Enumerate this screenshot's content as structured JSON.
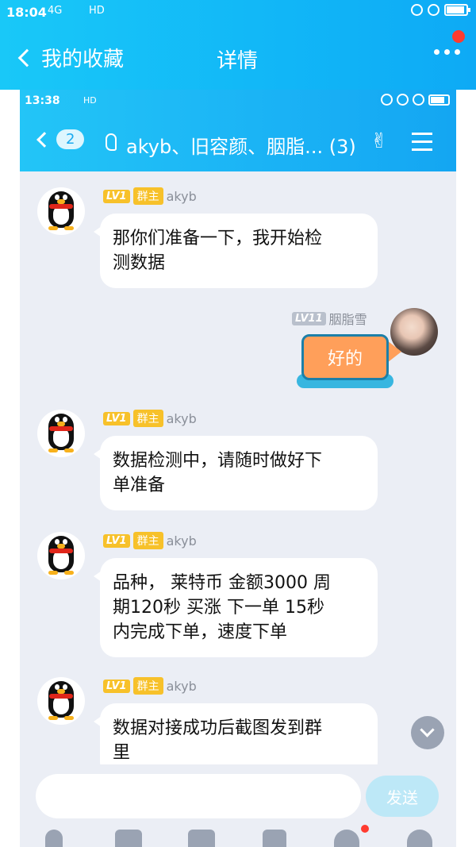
{
  "outer_status": {
    "time": "18:04",
    "signal": "4G",
    "network": "HD"
  },
  "outer_header": {
    "back_label": "我的收藏",
    "title": "详情"
  },
  "inner_status": {
    "time": "13:38",
    "network": "HD"
  },
  "chat_header": {
    "unread_count": "2",
    "title": "akyb、旧容颜、胭脂...",
    "member_count": "(3)"
  },
  "messages": [
    {
      "level": "LV1",
      "role": "群主",
      "name": "akyb",
      "text_line1": "那你们准备一下，我开始检",
      "text_line2": "测数据"
    },
    {
      "level": "LV11",
      "name": "胭脂雪",
      "sticker_text": "好的"
    },
    {
      "level": "LV1",
      "role": "群主",
      "name": "akyb",
      "text_line1": "数据检测中，请随时做好下",
      "text_line2": "单准备"
    },
    {
      "level": "LV1",
      "role": "群主",
      "name": "akyb",
      "text_line1": "品种， 莱特币 金额3000 周",
      "text_line2": "期120秒 买涨 下一单 15秒",
      "text_line3": "内完成下单，速度下单"
    },
    {
      "level": "LV1",
      "role": "群主",
      "name": "akyb",
      "text_line1": "数据对接成功后截图发到群",
      "text_line2": "里"
    }
  ],
  "input": {
    "placeholder": "",
    "send_label": "发送"
  }
}
